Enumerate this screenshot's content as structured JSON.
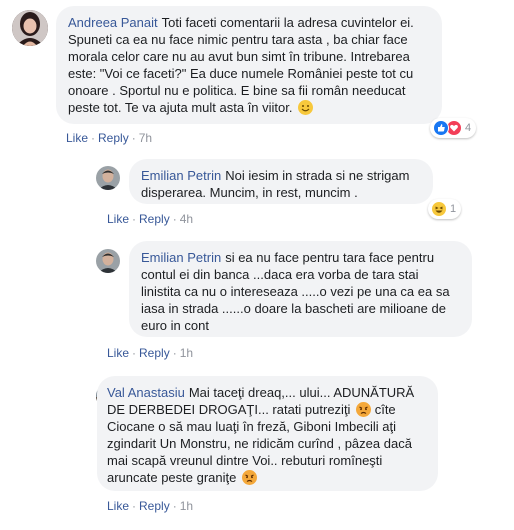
{
  "comments": [
    {
      "author": "Andreea Panait",
      "text": "Toti faceti comentarii la adresa cuvintelor ei. Spuneti ca ea nu face nimic pentru tara asta , ba chiar face morala celor care nu au avut bun simt în tribune. Intrebarea este: \"Voi ce faceti?\" Ea duce numele României peste tot cu onoare . Sportul nu e politica. E bine sa fii român needucat peste tot. Te va ajuta mult asta în viitor.",
      "like_label": "Like",
      "reply_label": "Reply",
      "time": "7h",
      "reaction_count": "4"
    },
    {
      "author": "Emilian Petrin",
      "text": "Noi iesim in strada si ne strigam disperarea. Muncim, in rest, muncim .",
      "like_label": "Like",
      "reply_label": "Reply",
      "time": "4h",
      "reaction_count": "1"
    },
    {
      "author": "Emilian Petrin",
      "text": "si ea nu face pentru tara face pentru contul ei din banca ...daca era vorba de tara stai linistita ca nu o intereseaza .....o vezi pe una ca ea sa iasa in strada ......o doare la bascheti are milioane de euro in cont",
      "like_label": "Like",
      "reply_label": "Reply",
      "time": "1h"
    },
    {
      "author": "Val Anastasiu",
      "text_part1": "Mai taceţi dreaq,... ului... ADUNĂTURĂ DE DERBEDEI DROGAŢI... ratati putreziţi",
      "text_part2": "cîte Ciocane o să mau luaţi în freză, Giboni Imbecili aţi zgindarit Un Monstru, ne ridicăm curînd , pâzea dacă mai scapă vreunul dintre Voi.. rebuturi romîneşti aruncate peste graniţe",
      "like_label": "Like",
      "reply_label": "Reply",
      "time": "1h"
    }
  ],
  "colors": {
    "name": "#385898",
    "bubble": "#f2f3f5",
    "meta": "#90949c"
  }
}
